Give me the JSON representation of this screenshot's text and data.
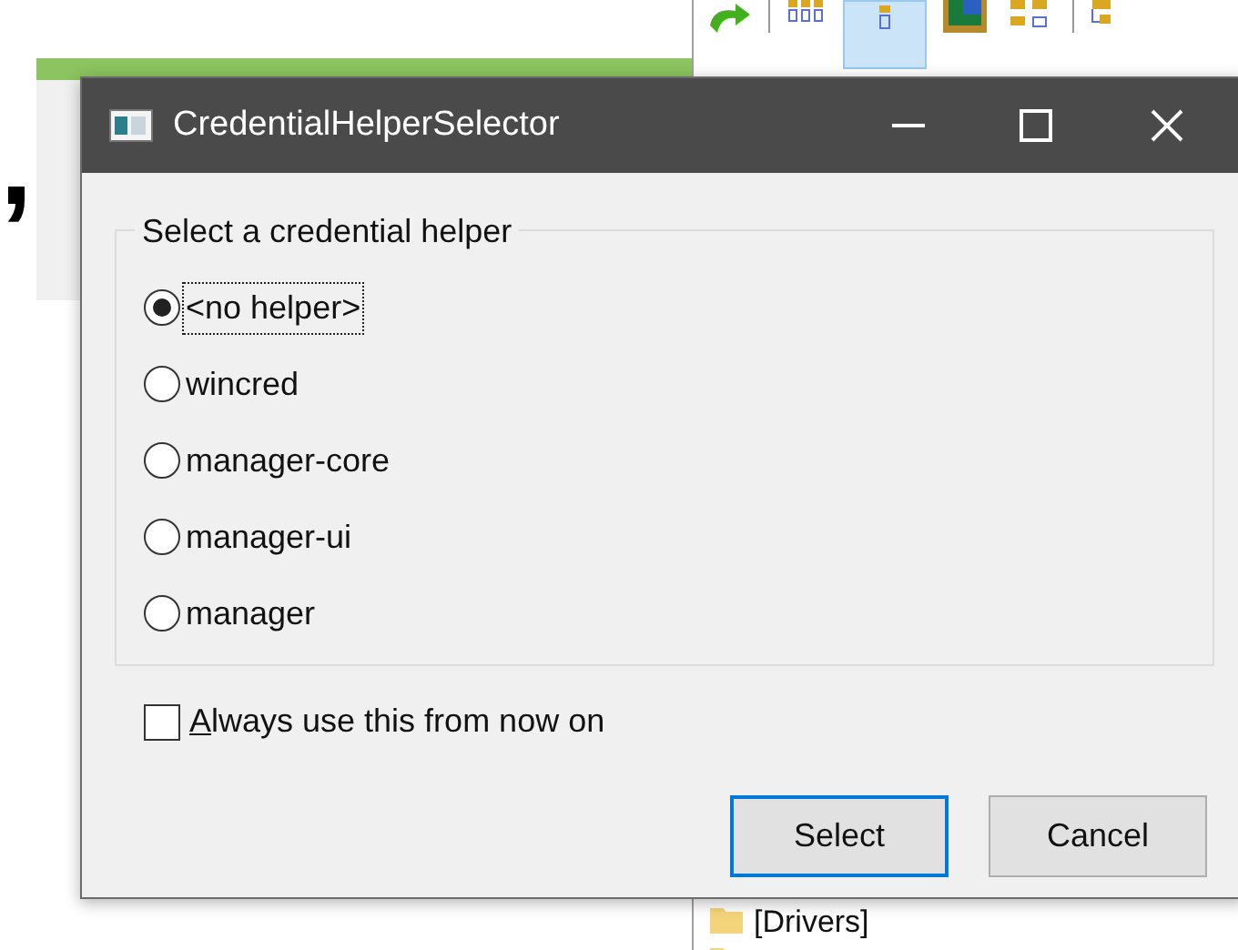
{
  "background": {
    "mark": ",",
    "folders": [
      {
        "kind": "labeled",
        "label": "[Drivers]"
      },
      {
        "kind": "icon_only"
      }
    ]
  },
  "dialog": {
    "title": "CredentialHelperSelector",
    "group_label": "Select a credential helper",
    "options": [
      {
        "label": "<no helper>",
        "selected": true,
        "focused": true
      },
      {
        "label": "wincred",
        "selected": false,
        "focused": false
      },
      {
        "label": "manager-core",
        "selected": false,
        "focused": false
      },
      {
        "label": "manager-ui",
        "selected": false,
        "focused": false
      },
      {
        "label": "manager",
        "selected": false,
        "focused": false
      }
    ],
    "always_use": {
      "label": "**A**lways use this from now on",
      "checked": false
    },
    "buttons": [
      {
        "label": "Select",
        "default": true
      },
      {
        "label": "Cancel",
        "default": false
      }
    ]
  }
}
